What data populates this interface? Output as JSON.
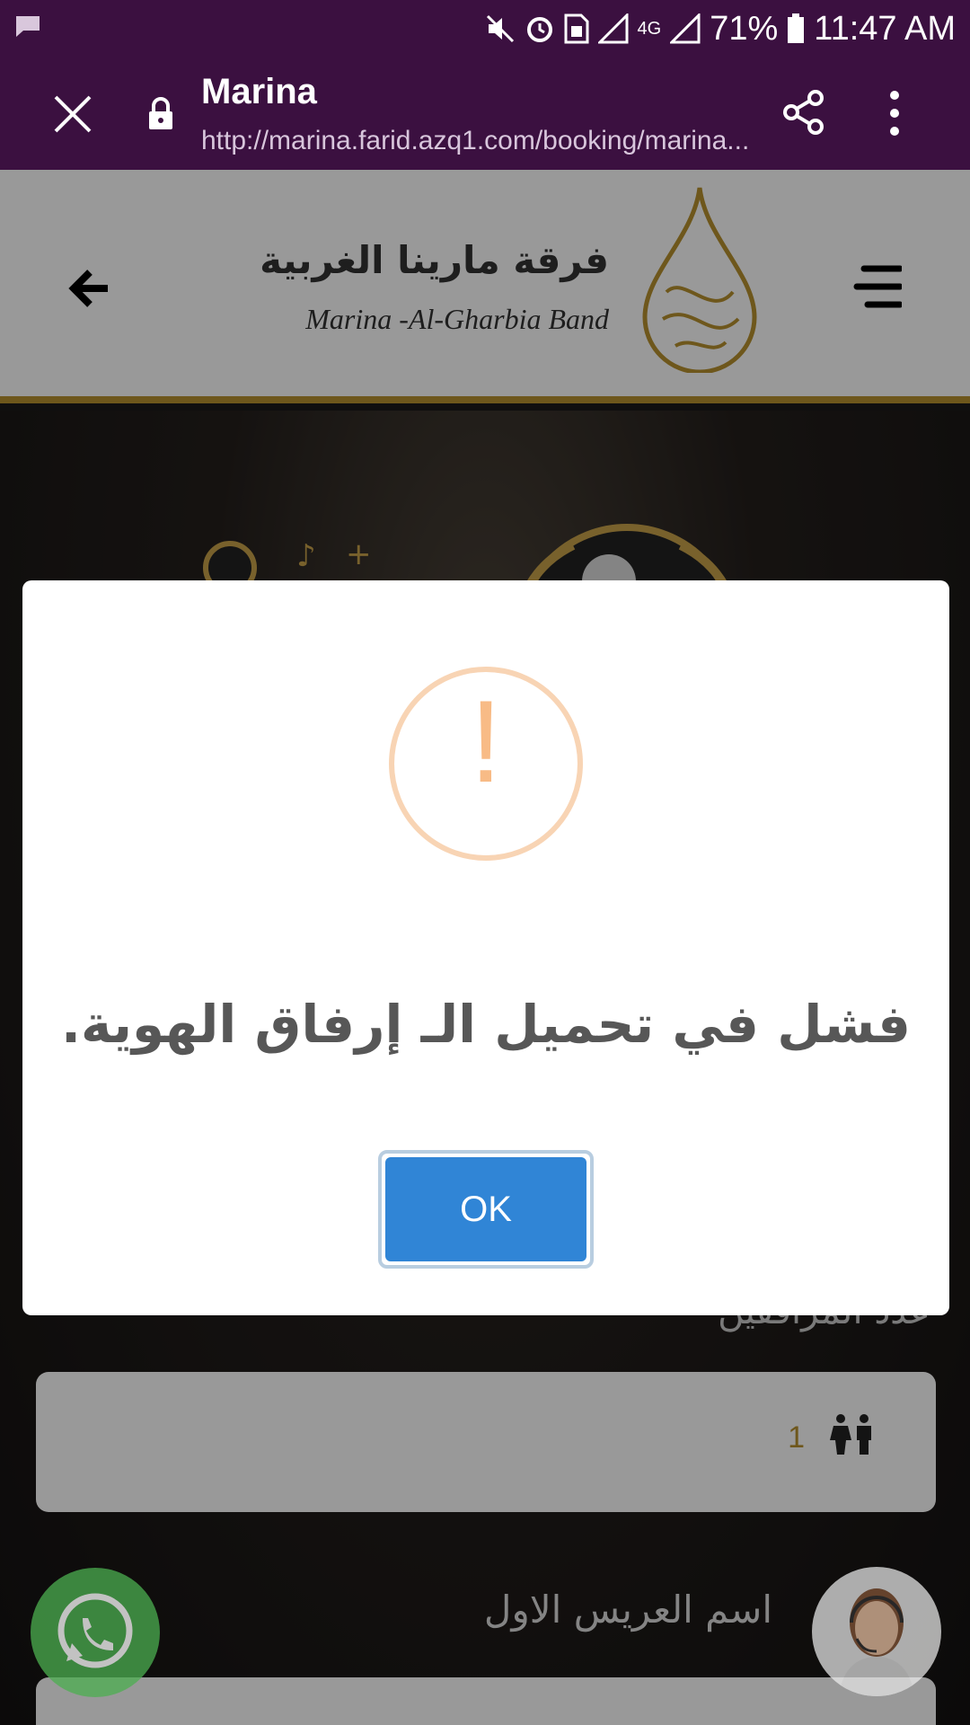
{
  "status_bar": {
    "battery": "71%",
    "time": "11:47 AM",
    "network": "4G",
    "icons": [
      "message-icon",
      "mute-icon",
      "alarm-icon",
      "sim-icon",
      "signal-icon",
      "battery-icon"
    ]
  },
  "tab_bar": {
    "title": "Marina",
    "url": "http://marina.farid.azq1.com/booking/marina..."
  },
  "site_header": {
    "brand_ar": "فرقة مارينا الغربية",
    "brand_en": "Marina -Al-Gharbia Band"
  },
  "page": {
    "field_label": "عدد المرافقين",
    "field_value": "1",
    "groom_label": "اسم العريس الاول"
  },
  "dialog": {
    "icon_glyph": "!",
    "message": "فشل في تحميل الـ إرفاق الهوية.",
    "ok_label": "OK"
  },
  "colors": {
    "chrome": "#3b1040",
    "gold": "#b8912f",
    "ok_button": "#3085d6",
    "warning": "#f8bb86",
    "whatsapp": "#4caf50"
  }
}
